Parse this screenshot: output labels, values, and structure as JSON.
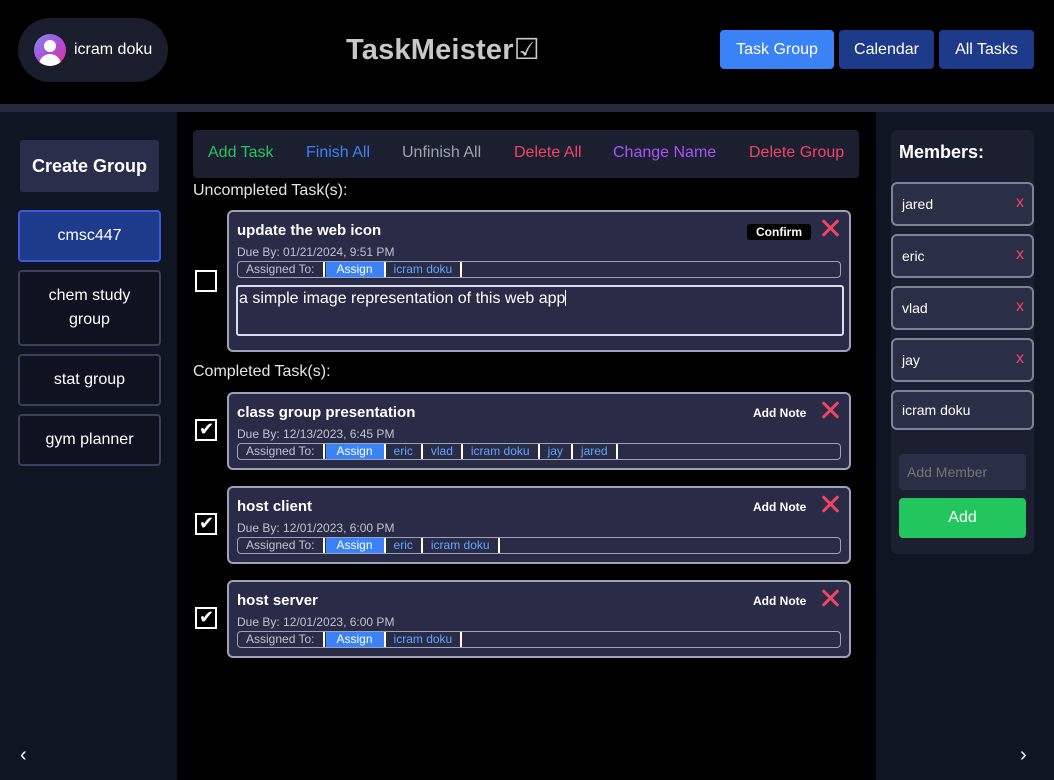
{
  "header": {
    "user_name": "icram doku",
    "app_title": "TaskMeister☑",
    "nav": [
      "Task Group",
      "Calendar",
      "All Tasks"
    ]
  },
  "sidebar": {
    "create_group": "Create Group",
    "groups": [
      "cmsc447",
      "chem study group",
      "stat group",
      "gym planner"
    ],
    "prev_arrow": "‹"
  },
  "toolbar": {
    "add_task": "Add Task",
    "finish_all": "Finish All",
    "unfinish_all": "Unfinish All",
    "delete_all": "Delete All",
    "change_name": "Change Name",
    "delete_group": "Delete Group"
  },
  "uncompleted_label": "Uncompleted Task(s):",
  "completed_label": "Completed Task(s):",
  "assigned_label": "Assigned To:",
  "assign_label": "Assign",
  "confirm_label": "Confirm",
  "add_note_label": "Add Note",
  "uncompleted_tasks": [
    {
      "title": "update the web icon",
      "due": "Due By: 01/21/2024, 9:51 PM",
      "assignees": [
        "icram doku"
      ],
      "note": "a simple image representation of this web app"
    }
  ],
  "completed_tasks": [
    {
      "title": "class group presentation",
      "due": "Due By: 12/13/2023, 6:45 PM",
      "assignees": [
        "eric",
        "vlad",
        "icram doku",
        "jay",
        "jared"
      ]
    },
    {
      "title": "host client",
      "due": "Due By: 12/01/2023, 6:00 PM",
      "assignees": [
        "eric",
        "icram doku"
      ]
    },
    {
      "title": "host server",
      "due": "Due By: 12/01/2023, 6:00 PM",
      "assignees": [
        "icram doku"
      ]
    }
  ],
  "members": {
    "title": "Members:",
    "list": [
      "jared",
      "eric",
      "vlad",
      "jay",
      "icram doku"
    ],
    "remove_symbol": "x",
    "add_placeholder": "Add Member",
    "add_button": "Add",
    "next_arrow": "›"
  },
  "colors": {
    "add_task": "#22c55e",
    "finish_all": "#3b82f6",
    "unfinish_all": "#9ca3af",
    "delete_all": "#ef4466",
    "change_name": "#a855f7",
    "delete_group": "#ef4466",
    "active_nav": "#3b82f6",
    "nav": "#1e3a8a"
  }
}
